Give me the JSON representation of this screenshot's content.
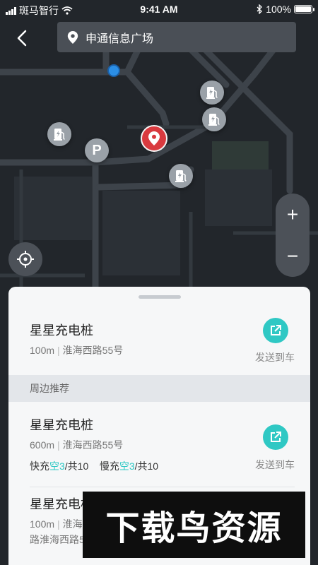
{
  "status_bar": {
    "carrier": "斑马智行",
    "time": "9:41 AM",
    "battery": "100%"
  },
  "search": {
    "value": "申通信息广场"
  },
  "map": {
    "pins": [
      {
        "type": "charging",
        "icon": "charging-station-icon"
      },
      {
        "type": "charging",
        "icon": "charging-station-icon"
      },
      {
        "type": "charging",
        "icon": "charging-station-icon"
      },
      {
        "type": "charging",
        "icon": "charging-station-icon"
      },
      {
        "type": "parking",
        "label": "P"
      }
    ],
    "zoom_in": "+",
    "zoom_out": "−"
  },
  "selected": {
    "name": "星星充电桩",
    "distance": "100m",
    "address": "淮海西路55号",
    "send_label": "发送到车"
  },
  "nearby": {
    "header": "周边推荐",
    "items": [
      {
        "name": "星星充电桩",
        "distance": "600m",
        "address": "淮海西路55号",
        "fast_prefix": "快充",
        "fast_free": "空3",
        "fast_total": "/共10",
        "slow_prefix": "慢充",
        "slow_free": "空3",
        "slow_total": "/共10",
        "send_label": "发送到车"
      },
      {
        "name": "星星充电桩",
        "distance": "100m",
        "address_partial": "淮海",
        "address_line2": "路淮海西路5"
      }
    ]
  },
  "watermark": "下载鸟资源",
  "colors": {
    "accent": "#2fc8c4",
    "location_pin": "#d93a3f",
    "map_bg": "#22262b"
  }
}
